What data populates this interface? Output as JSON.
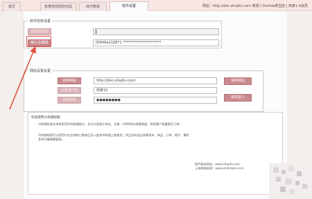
{
  "window": {
    "tabs": [
      {
        "label": "首页"
      },
      {
        "label": "批量修改网店商品"
      },
      {
        "label": "操作教程"
      },
      {
        "label": "软件设置"
      }
    ],
    "title": "网店：http://doc.shopfu.com 商城 | Duhhie类宝店 | 商家1.6会员"
  },
  "auth": {
    "group_title": "软件授权设置",
    "button_get_machine_code": "获取机器码",
    "button_input_code": "输入注册码",
    "machine_code": "",
    "register_code": "fDK4Re21Z871 **********************"
  },
  "login": {
    "group_title": "网站设置设置",
    "button_select_site": "选择网站",
    "button_set_account": "设置用户名",
    "button_set_password": "设置密码",
    "site_url": "http://doc.shopfu.com/",
    "username": "商家10",
    "password": "●●●●●●●●",
    "button_save_url": "保存网址",
    "button_test_login": "测试登入",
    "text_save_url": "",
    "text_test_login": ""
  },
  "notice": {
    "heading": "欢迎使用大商铺助理：",
    "line1": "1)商铺助理支持商家同步的数据格式，也可以直接从淘宝、天猫、1688等站采集数据，帮助客户批量提升订单）",
    "line2": "2)商铺助理可以把用户在仓储和已售商品导入起来并快速上架售卖，并且还有选品采集发布、商品、订单、图片、属性",
    "line3": "多样可编辑模板图。",
    "contact_line1": "照片服务网站：www.shopfu.com",
    "contact_line2": "上海商铺网络：www.wnhstzon.com"
  },
  "colors": {
    "accent": "#c98a8e",
    "highlight": "#e0513f"
  }
}
